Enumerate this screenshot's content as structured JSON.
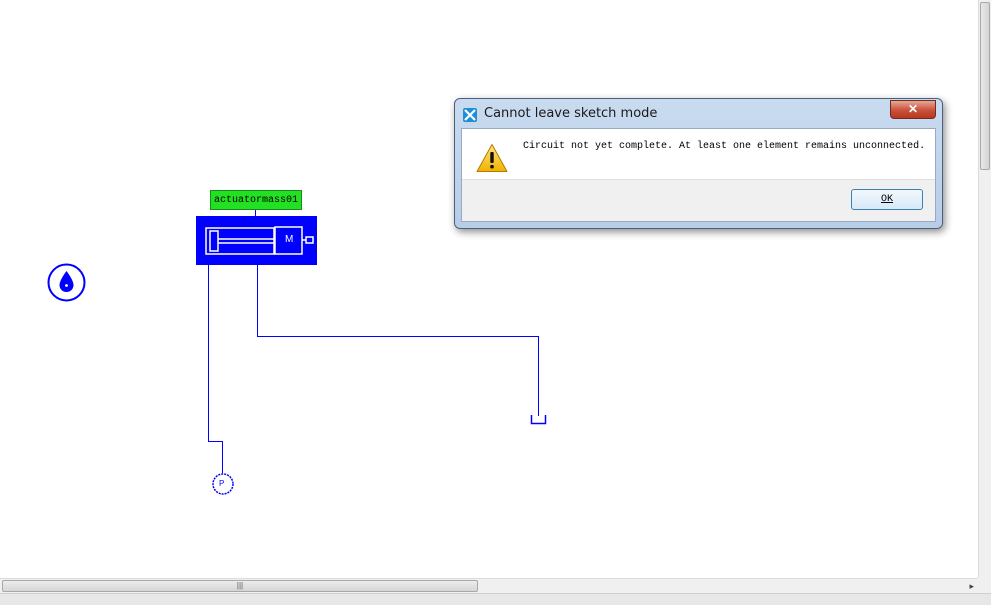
{
  "canvas": {
    "element_label": "actuatormass01",
    "mass_symbol": "M",
    "pump_symbol": "P",
    "wire_color": "#0000ff",
    "label_color": "#22e022"
  },
  "scrollbars": {
    "h_grip": "|||"
  },
  "dialog": {
    "title": "Cannot leave sketch mode",
    "close_symbol": "✕",
    "icon": "warning-icon",
    "message": "Circuit not yet complete. At least one element remains unconnected.",
    "ok_label": "OK"
  }
}
